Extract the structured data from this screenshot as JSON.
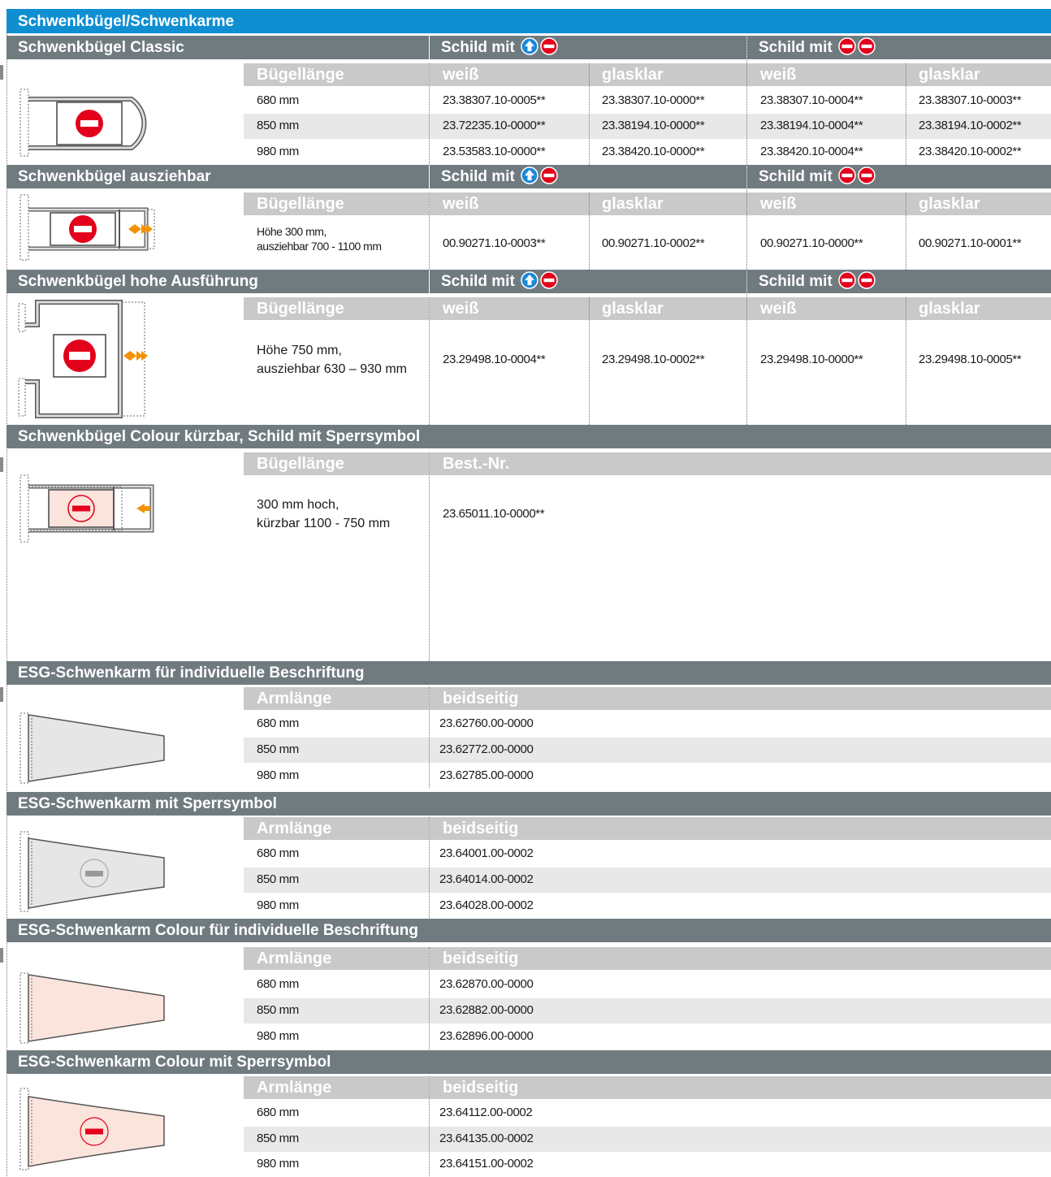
{
  "title": "Schwenkbügel/Schwenkarme",
  "sections": {
    "classic": {
      "title": "Schwenkbügel Classic",
      "schild1": "Schild mit",
      "schild2": "Schild mit",
      "headers": [
        "Bügellänge",
        "weiß",
        "glasklar",
        "weiß",
        "glasklar"
      ],
      "rows": [
        [
          "680 mm",
          "23.38307.10-0005**",
          "23.38307.10-0000**",
          "23.38307.10-0004**",
          "23.38307.10-0003**"
        ],
        [
          "850 mm",
          "23.72235.10-0000**",
          "23.38194.10-0000**",
          "23.38194.10-0004**",
          "23.38194.10-0002**"
        ],
        [
          "980 mm",
          "23.53583.10-0000**",
          "23.38420.10-0000**",
          "23.38420.10-0004**",
          "23.38420.10-0002**"
        ]
      ]
    },
    "ausziehbar": {
      "title": "Schwenkbügel ausziehbar",
      "schild1": "Schild mit",
      "schild2": "Schild mit",
      "headers": [
        "Bügellänge",
        "weiß",
        "glasklar",
        "weiß",
        "glasklar"
      ],
      "length_line1": "Höhe 300 mm,",
      "length_line2": "ausziehbar 700 - 1100 mm",
      "values": [
        "00.90271.10-0003**",
        "00.90271.10-0002**",
        "00.90271.10-0000**",
        "00.90271.10-0001**"
      ]
    },
    "hohe": {
      "title": "Schwenkbügel hohe Ausführung",
      "schild1": "Schild mit",
      "schild2": "Schild mit",
      "headers": [
        "Bügellänge",
        "weiß",
        "glasklar",
        "weiß",
        "glasklar"
      ],
      "length_line1": "Höhe 750 mm,",
      "length_line2": "ausziehbar 630 – 930 mm",
      "values": [
        "23.29498.10-0004**",
        "23.29498.10-0002**",
        "23.29498.10-0000**",
        "23.29498.10-0005**"
      ]
    },
    "colour": {
      "title": "Schwenkbügel Colour kürzbar, Schild mit Sperrsymbol",
      "headers": [
        "Bügellänge",
        "Best.-Nr."
      ],
      "length_line1": "300 mm hoch,",
      "length_line2": "kürzbar 1100 - 750 mm",
      "value": "23.65011.10-0000**"
    },
    "esg_individuell": {
      "title": "ESG-Schwenkarm für individuelle Beschriftung",
      "headers": [
        "Armlänge",
        "beidseitig"
      ],
      "rows": [
        [
          "680 mm",
          "23.62760.00-0000"
        ],
        [
          "850 mm",
          "23.62772.00-0000"
        ],
        [
          "980 mm",
          "23.62785.00-0000"
        ]
      ]
    },
    "esg_sperr": {
      "title": "ESG-Schwenkarm mit Sperrsymbol",
      "headers": [
        "Armlänge",
        "beidseitig"
      ],
      "rows": [
        [
          "680 mm",
          "23.64001.00-0002"
        ],
        [
          "850 mm",
          "23.64014.00-0002"
        ],
        [
          "980 mm",
          "23.64028.00-0002"
        ]
      ]
    },
    "esg_colour_individuell": {
      "title": "ESG-Schwenkarm Colour für individuelle Beschriftung",
      "headers": [
        "Armlänge",
        "beidseitig"
      ],
      "rows": [
        [
          "680 mm",
          "23.62870.00-0000"
        ],
        [
          "850 mm",
          "23.62882.00-0000"
        ],
        [
          "980 mm",
          "23.62896.00-0000"
        ]
      ]
    },
    "esg_colour_sperr": {
      "title": "ESG-Schwenkarm Colour mit Sperrsymbol",
      "headers": [
        "Armlänge",
        "beidseitig"
      ],
      "rows": [
        [
          "680 mm",
          "23.64112.00-0002"
        ],
        [
          "850 mm",
          "23.64135.00-0002"
        ],
        [
          "980 mm",
          "23.64151.00-0002"
        ]
      ]
    }
  },
  "icons": {
    "arrow_sign": "blue-arrow-up-icon",
    "no_entry_sign": "red-no-entry-icon"
  },
  "colors": {
    "title_bar": "#0f8fd2",
    "section_bar": "#707b80",
    "header_bar": "#c9c9c9",
    "row_shade": "#e8e8e8",
    "sign_red": "#e3001b",
    "sign_blue": "#1b87d6",
    "arrow_orange": "#f39200",
    "colour_panel": "#fbe4dc"
  }
}
